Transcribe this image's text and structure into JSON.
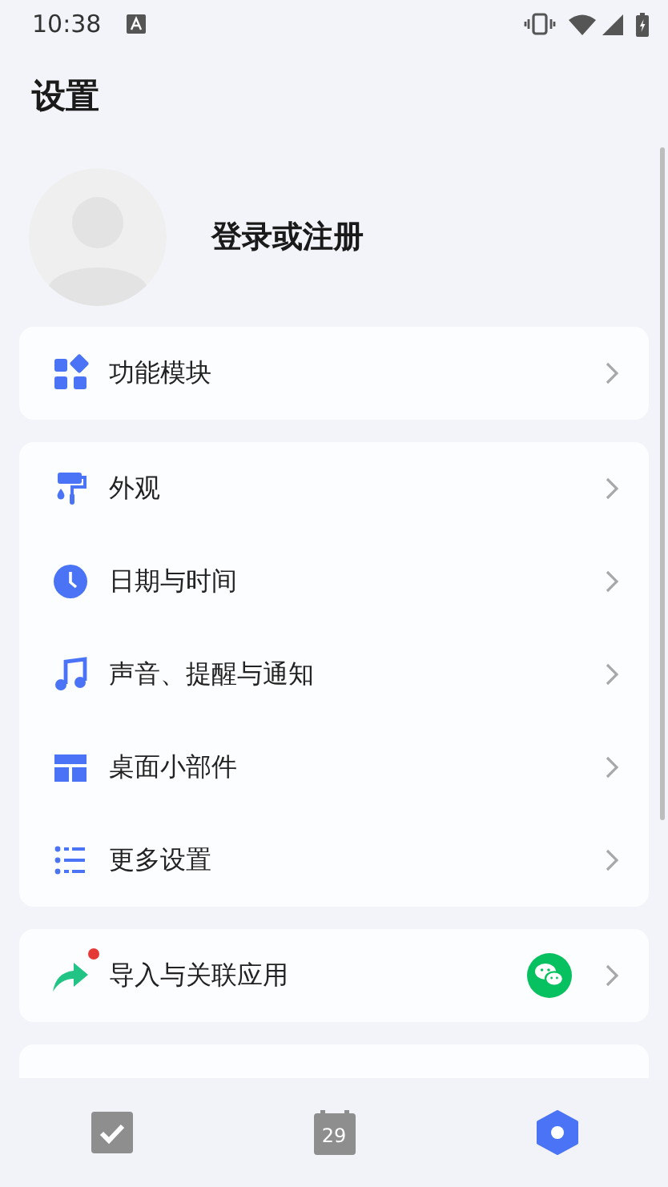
{
  "status_bar": {
    "time": "10:38"
  },
  "title": "设置",
  "profile": {
    "label": "登录或注册"
  },
  "groups": [
    {
      "items": [
        {
          "kind": "modules",
          "label": "功能模块"
        }
      ]
    },
    {
      "items": [
        {
          "kind": "brush",
          "label": "外观"
        },
        {
          "kind": "clock",
          "label": "日期与时间"
        },
        {
          "kind": "music",
          "label": "声音、提醒与通知"
        },
        {
          "kind": "widgets",
          "label": "桌面小部件"
        },
        {
          "kind": "list",
          "label": "更多设置"
        }
      ]
    },
    {
      "items": [
        {
          "kind": "share",
          "label": "导入与关联应用",
          "badge_dot": true,
          "wechat_linked": true
        }
      ]
    }
  ],
  "bottom_nav": [
    {
      "kind": "tasks",
      "selected": false
    },
    {
      "kind": "calendar",
      "label": "29",
      "selected": false
    },
    {
      "kind": "settings",
      "selected": true
    }
  ]
}
